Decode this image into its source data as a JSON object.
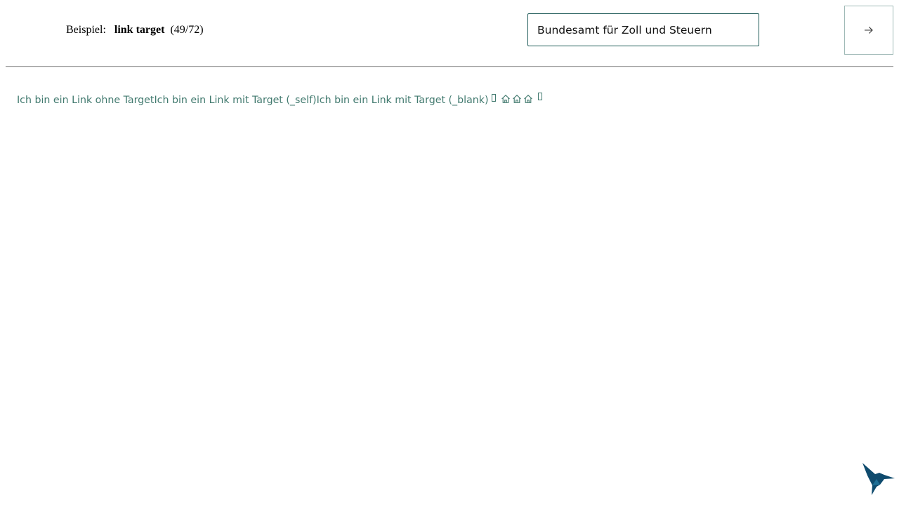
{
  "header": {
    "example_prefix": "Beispiel:",
    "example_name": "link target",
    "example_counter": "(49/72)",
    "theme_select_value": "Bundesamt für Zoll und Steuern",
    "next_button_icon": "arrow-right-icon"
  },
  "links": [
    {
      "label": "Ich bin ein Link ohne Target"
    },
    {
      "label": "Ich bin ein Link mit Target (_self)"
    },
    {
      "label": "Ich bin ein Link mit Target (_blank)"
    }
  ],
  "icon_links": [
    {
      "icon": "missing-glyph-icon"
    },
    {
      "icon": "home-icon"
    },
    {
      "icon": "home-icon"
    },
    {
      "icon": "home-icon"
    },
    {
      "icon": "missing-glyph-icon"
    }
  ],
  "colors": {
    "link": "#427a6f",
    "select_border": "#1d5a57",
    "logo": "#0f4b6e"
  }
}
